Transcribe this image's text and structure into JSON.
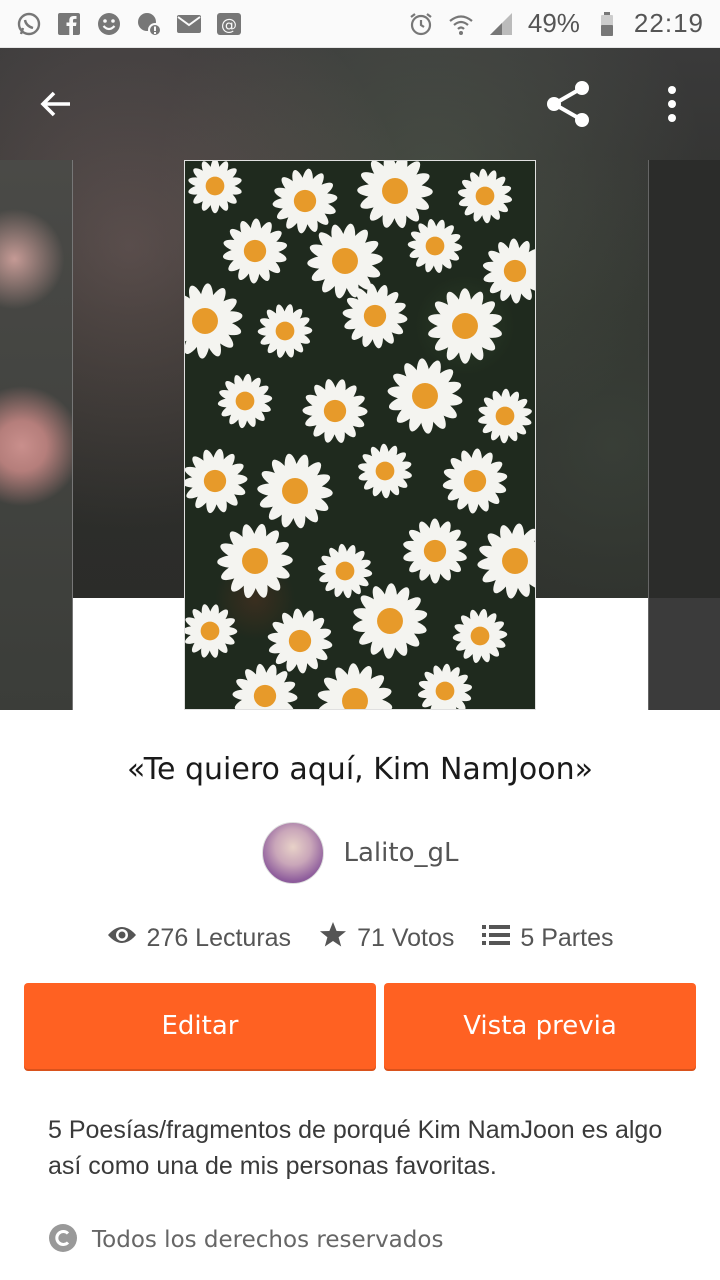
{
  "status_bar": {
    "battery": "49%",
    "time": "22:19",
    "left_icons": [
      "whatsapp-icon",
      "facebook-icon",
      "smiley-icon",
      "notification-icon",
      "mail-icon",
      "at-icon"
    ],
    "right_icons": [
      "alarm-icon",
      "wifi-icon",
      "signal-icon",
      "battery-icon"
    ]
  },
  "toolbar": {
    "back_icon": "arrow-left-icon",
    "share_icon": "share-icon",
    "menu_icon": "more-vertical-icon"
  },
  "story": {
    "title": "«Te quiero aquí, Kim NamJoon»",
    "author": "Lalito_gL",
    "stats": [
      {
        "icon": "eye-icon",
        "label": "276 Lecturas"
      },
      {
        "icon": "star-icon",
        "label": "71 Votos"
      },
      {
        "icon": "list-icon",
        "label": "5 Partes"
      }
    ],
    "edit_label": "Editar",
    "preview_label": "Vista previa",
    "description": "5 Poesías/fragmentos de porqué Kim NamJoon es algo así como una de mis personas favoritas.",
    "copyright": "Todos los derechos reservados"
  },
  "colors": {
    "accent": "#ff6122",
    "text": "#1a1a1a",
    "muted": "#555555"
  }
}
